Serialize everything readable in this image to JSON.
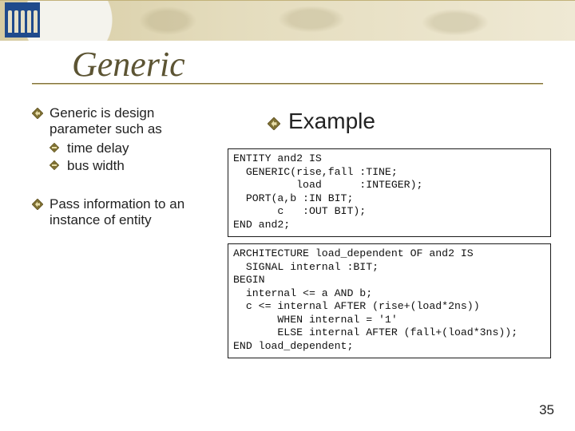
{
  "title": "Generic",
  "left": {
    "p1": "Generic is design parameter such as",
    "s1": "time delay",
    "s2": "bus width",
    "p2": "Pass information to an instance of entity"
  },
  "right": {
    "example_label": "Example",
    "code1": "ENTITY and2 IS\n  GENERIC(rise,fall :TINE;\n          load      :INTEGER);\n  PORT(a,b :IN BIT;\n       c   :OUT BIT);\nEND and2;",
    "code2": "ARCHITECTURE load_dependent OF and2 IS\n  SIGNAL internal :BIT;\nBEGIN\n  internal <= a AND b;\n  c <= internal AFTER (rise+(load*2ns))\n       WHEN internal = '1'\n       ELSE internal AFTER (fall+(load*3ns));\nEND load_dependent;"
  },
  "slide_number": "35"
}
